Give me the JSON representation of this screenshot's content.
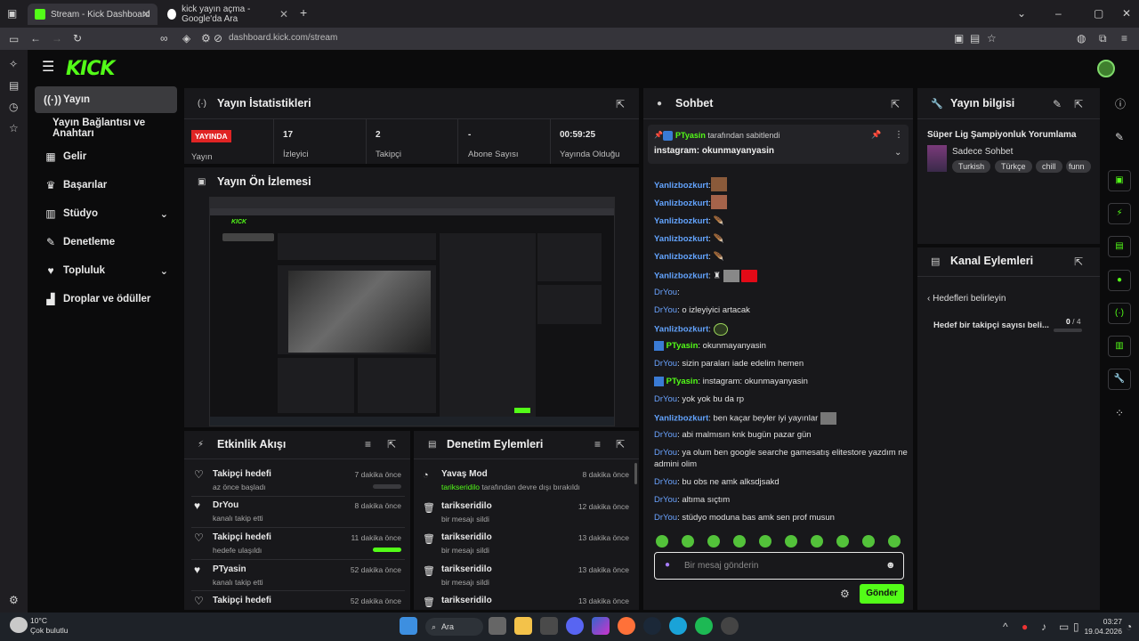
{
  "browser": {
    "tabs": [
      {
        "title": "Stream - Kick Dashboard",
        "active": true
      },
      {
        "title": "kick yayın açma - Google'da Ara",
        "active": false
      }
    ],
    "url": "dashboard.kick.com/stream"
  },
  "app": {
    "logo": "KICK",
    "nav": [
      {
        "label": "Yayın",
        "icon": "broadcast-icon",
        "active": true
      },
      {
        "label": "Yayın Bağlantısı ve Anahtarı"
      },
      {
        "label": "Gelir",
        "icon": "revenue-icon"
      },
      {
        "label": "Başarılar",
        "icon": "trophy-icon"
      },
      {
        "label": "Stüdyo",
        "icon": "studio-icon"
      },
      {
        "label": "Denetleme",
        "icon": "moderation-icon"
      },
      {
        "label": "Topluluk",
        "icon": "community-icon"
      },
      {
        "label": "Droplar ve ödüller",
        "icon": "rewards-icon"
      }
    ]
  },
  "stats": {
    "title": "Yayın İstatistikleri",
    "badge": "YAYINDA",
    "status_label": "Yayın",
    "items": [
      {
        "value": "17",
        "label": "İzleyici"
      },
      {
        "value": "2",
        "label": "Takipçi"
      },
      {
        "value": "-",
        "label": "Abone Sayısı"
      },
      {
        "value": "00:59:25",
        "label": "Yayında Olduğu"
      }
    ]
  },
  "preview": {
    "title": "Yayın Ön İzlemesi"
  },
  "events": {
    "title": "Etkinlik Akışı",
    "rows": [
      {
        "title": "Takipçi hedefi",
        "sub": "az önce başladı",
        "time": "7 dakika önce",
        "progress": 0.0
      },
      {
        "title": "DrYou",
        "sub": "kanalı takip etti",
        "time": "8 dakika önce"
      },
      {
        "title": "Takipçi hedefi",
        "sub": "hedefe ulaşıldı",
        "time": "11 dakika önce",
        "progress": 1.0
      },
      {
        "title": "PTyasin",
        "sub": "kanalı takip etti",
        "time": "52 dakika önce"
      },
      {
        "title": "Takipçi hedefi",
        "sub": "",
        "time": "52 dakika önce"
      }
    ]
  },
  "moderation": {
    "title": "Denetim Eylemleri",
    "rows": [
      {
        "title": "Yavaş Mod",
        "sub_user": "tarikseridilo",
        "sub": " tarafından devre dışı bırakıldı",
        "time": "8 dakika önce"
      },
      {
        "title": "tarikseridilo",
        "sub": "bir mesajı sildi",
        "time": "12 dakika önce"
      },
      {
        "title": "tarikseridilo",
        "sub": "bir mesajı sildi",
        "time": "13 dakika önce"
      },
      {
        "title": "tarikseridilo",
        "sub": "bir mesajı sildi",
        "time": "13 dakika önce"
      },
      {
        "title": "tarikseridilo",
        "sub": "",
        "time": "13 dakika önce"
      }
    ]
  },
  "chat": {
    "title": "Sohbet",
    "pinned_by": "PTyasin",
    "pinned_suffix": " tarafından sabitlendi",
    "pinned_message": "instagram: okunmayanyasin",
    "messages": [
      {
        "user": "Yanlizbozkurt",
        "text": ""
      },
      {
        "user": "Yanlizbozkurt",
        "text": ""
      },
      {
        "user": "Yanlizbozkurt",
        "text": ""
      },
      {
        "user": "Yanlizbozkurt",
        "text": ""
      },
      {
        "user": "Yanlizbozkurt",
        "text": ""
      },
      {
        "user": "Yanlizbozkurt",
        "text": ""
      },
      {
        "user": "DrYou",
        "text": ""
      },
      {
        "user": "DrYou",
        "text": "o izleyiyici artacak"
      },
      {
        "user": "Yanlizbozkurt",
        "text": ""
      },
      {
        "user": "PTyasin",
        "text": "okunmayanyasin"
      },
      {
        "user": "DrYou",
        "text": "sizin paraları iade edelim hemen"
      },
      {
        "user": "PTyasin",
        "text": "instagram: okunmayanyasin"
      },
      {
        "user": "DrYou",
        "text": "yok yok bu da rp"
      },
      {
        "user": "Yanlizbozkurt",
        "text": "ben kaçar beyler iyi yayınlar"
      },
      {
        "user": "DrYou",
        "text": "abi malmısın knk bugün pazar gün"
      },
      {
        "user": "DrYou",
        "text": "ya olum ben google searche gamesatış elitestore yazdım ne"
      },
      {
        "user": "",
        "text": "admini olim"
      },
      {
        "user": "DrYou",
        "text": "bu obs ne amk alksdjsakd"
      },
      {
        "user": "DrYou",
        "text": "altıma sıçtım"
      },
      {
        "user": "DrYou",
        "text": "stüdyo moduna bas amk sen prof musun"
      }
    ],
    "input_placeholder": "Bir mesaj gönderin",
    "send_label": "Gönder"
  },
  "info": {
    "title": "Yayın bilgisi",
    "stream_title": "Süper Lig Şampiyonluk Yorumlama",
    "category": "Sadece Sohbet",
    "tags": [
      "Turkish",
      "Türkçe",
      "chill",
      "funn"
    ]
  },
  "channel_actions": {
    "title": "Kanal Eylemleri",
    "back_label": "Hedefleri belirleyin",
    "goal_label": "Hedef bir takipçi sayısı beli...",
    "goal_current": "0",
    "goal_total": "/ 4"
  },
  "taskbar": {
    "temp": "10°C",
    "weather": "Çok bulutlu",
    "search": "Ara",
    "time": "03:27",
    "date": "19.04.2026"
  }
}
